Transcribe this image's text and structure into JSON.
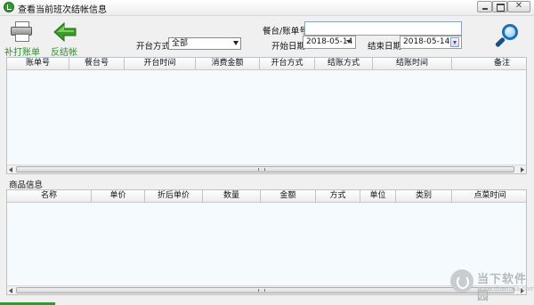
{
  "window": {
    "title": "查看当前班次结帐信息",
    "controls": {
      "minimize_icon": "minimize-icon",
      "maximize_icon": "maximize-icon",
      "close_label": "✕"
    }
  },
  "toolbar": {
    "reprint_label": "补打账单",
    "reverse_label": "反结帐",
    "reprint_icon": "printer-icon",
    "reverse_icon": "back-arrow-icon",
    "accent": "#2f8f2f"
  },
  "filters": {
    "table_bill_label": "餐台/账单号",
    "table_bill_value": "",
    "open_mode_label": "开台方式",
    "open_mode_value": "全部",
    "start_date_label": "开始日期",
    "start_date_value": "2018-05-14",
    "end_date_label": "结束日期",
    "end_date_value": "2018-05-14",
    "search_icon": "search-icon"
  },
  "bills_table": {
    "columns": [
      "账单号",
      "餐台号",
      "开台时间",
      "消费金额",
      "开台方式",
      "结账方式",
      "结账时间",
      "备注"
    ],
    "rows": []
  },
  "items_section": {
    "title": "商品信息",
    "columns": [
      "名称",
      "单价",
      "折后单价",
      "数量",
      "金额",
      "方式",
      "单位",
      "类别",
      "点菜时间"
    ],
    "rows": []
  },
  "watermark": {
    "text": "当下软件园",
    "url": "www.downxia.com"
  }
}
